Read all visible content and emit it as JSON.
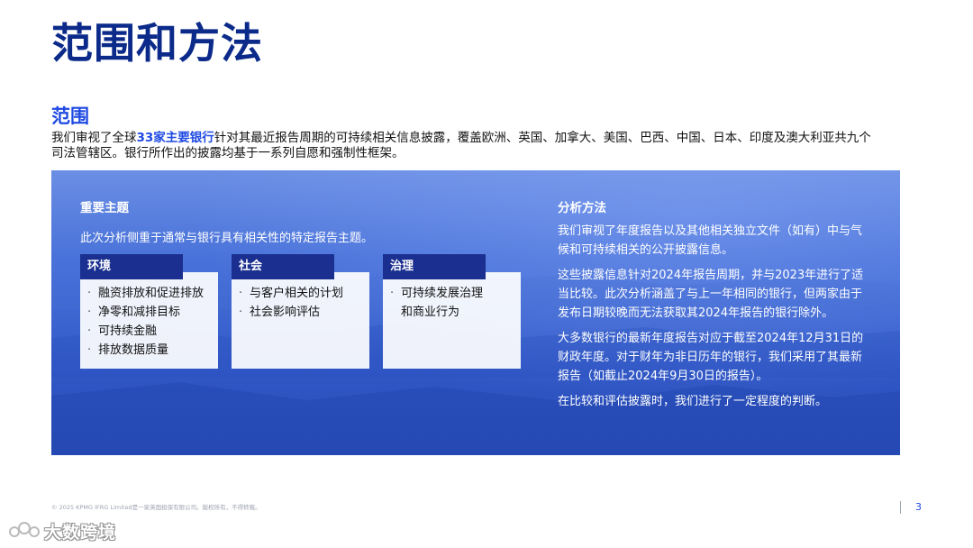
{
  "title": "范围和方法",
  "scope": {
    "heading": "范围",
    "text_before": "我们审视了全球",
    "highlight": "33家主要银行",
    "text_after": "针对其最近报告周期的可持续相关信息披露，覆盖欧洲、英国、加拿大、美国、巴西、中国、日本、印度及澳大利亚共九个司法管辖区。银行所作出的披露均基于一系列自愿和强制性框架。"
  },
  "key_topics": {
    "heading": "重要主题",
    "description": "此次分析侧重于通常与银行具有相关性的特定报告主题。",
    "categories": [
      {
        "name": "环境",
        "items": [
          "融资排放和促进排放",
          "净零和减排目标",
          "可持续金融",
          "排放数据质量"
        ]
      },
      {
        "name": "社会",
        "items": [
          "与客户相关的计划",
          "社会影响评估"
        ]
      },
      {
        "name": "治理",
        "items": [
          "可持续发展治理",
          "和商业行为"
        ]
      }
    ]
  },
  "methodology": {
    "heading": "分析方法",
    "paragraphs": [
      "我们审视了年度报告以及其他相关独立文件（如有）中与气候和可持续相关的公开披露信息。",
      "这些披露信息针对2024年报告周期，并与2023年进行了适当比较。此次分析涵盖了与上一年相同的银行，但两家由于发布日期较晚而无法获取其2024年报告的银行除外。",
      "大多数银行的最新年度报告对应于截至2024年12月31日的财政年度。对于财年为非日历年的银行，我们采用了其最新报告（如截止2024年9月30日的报告）。",
      "在比较和评估披露时，我们进行了一定程度的判断。"
    ]
  },
  "footer": {
    "copyright": "© 2025 KPMG IFRG Limited是一家英国担保有限公司。版权所有，不得转载。",
    "page_number": "3"
  },
  "watermark": {
    "text": "大数跨境"
  },
  "colors": {
    "title": "#0b2a8a",
    "accent": "#1e49e2",
    "tab": "#1a2f8f",
    "panel": "#3b63cf"
  }
}
